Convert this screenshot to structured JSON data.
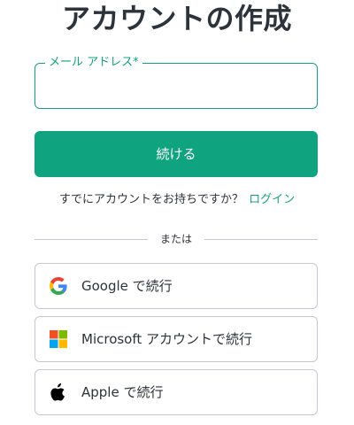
{
  "header": {
    "title": "アカウントの作成"
  },
  "form": {
    "email_label": "メール アドレス*",
    "email_value": "",
    "continue_label": "続ける"
  },
  "login": {
    "prompt": "すでにアカウントをお持ちですか？",
    "link_label": "ログイン"
  },
  "divider": {
    "label": "または"
  },
  "social": [
    {
      "icon": "google-icon",
      "label": "Google で続行"
    },
    {
      "icon": "microsoft-icon",
      "label": "Microsoft アカウントで続行"
    },
    {
      "icon": "apple-icon",
      "label": "Apple で続行"
    }
  ],
  "colors": {
    "accent": "#10a37f",
    "text": "#2d333a",
    "border": "#c2c8d0"
  }
}
